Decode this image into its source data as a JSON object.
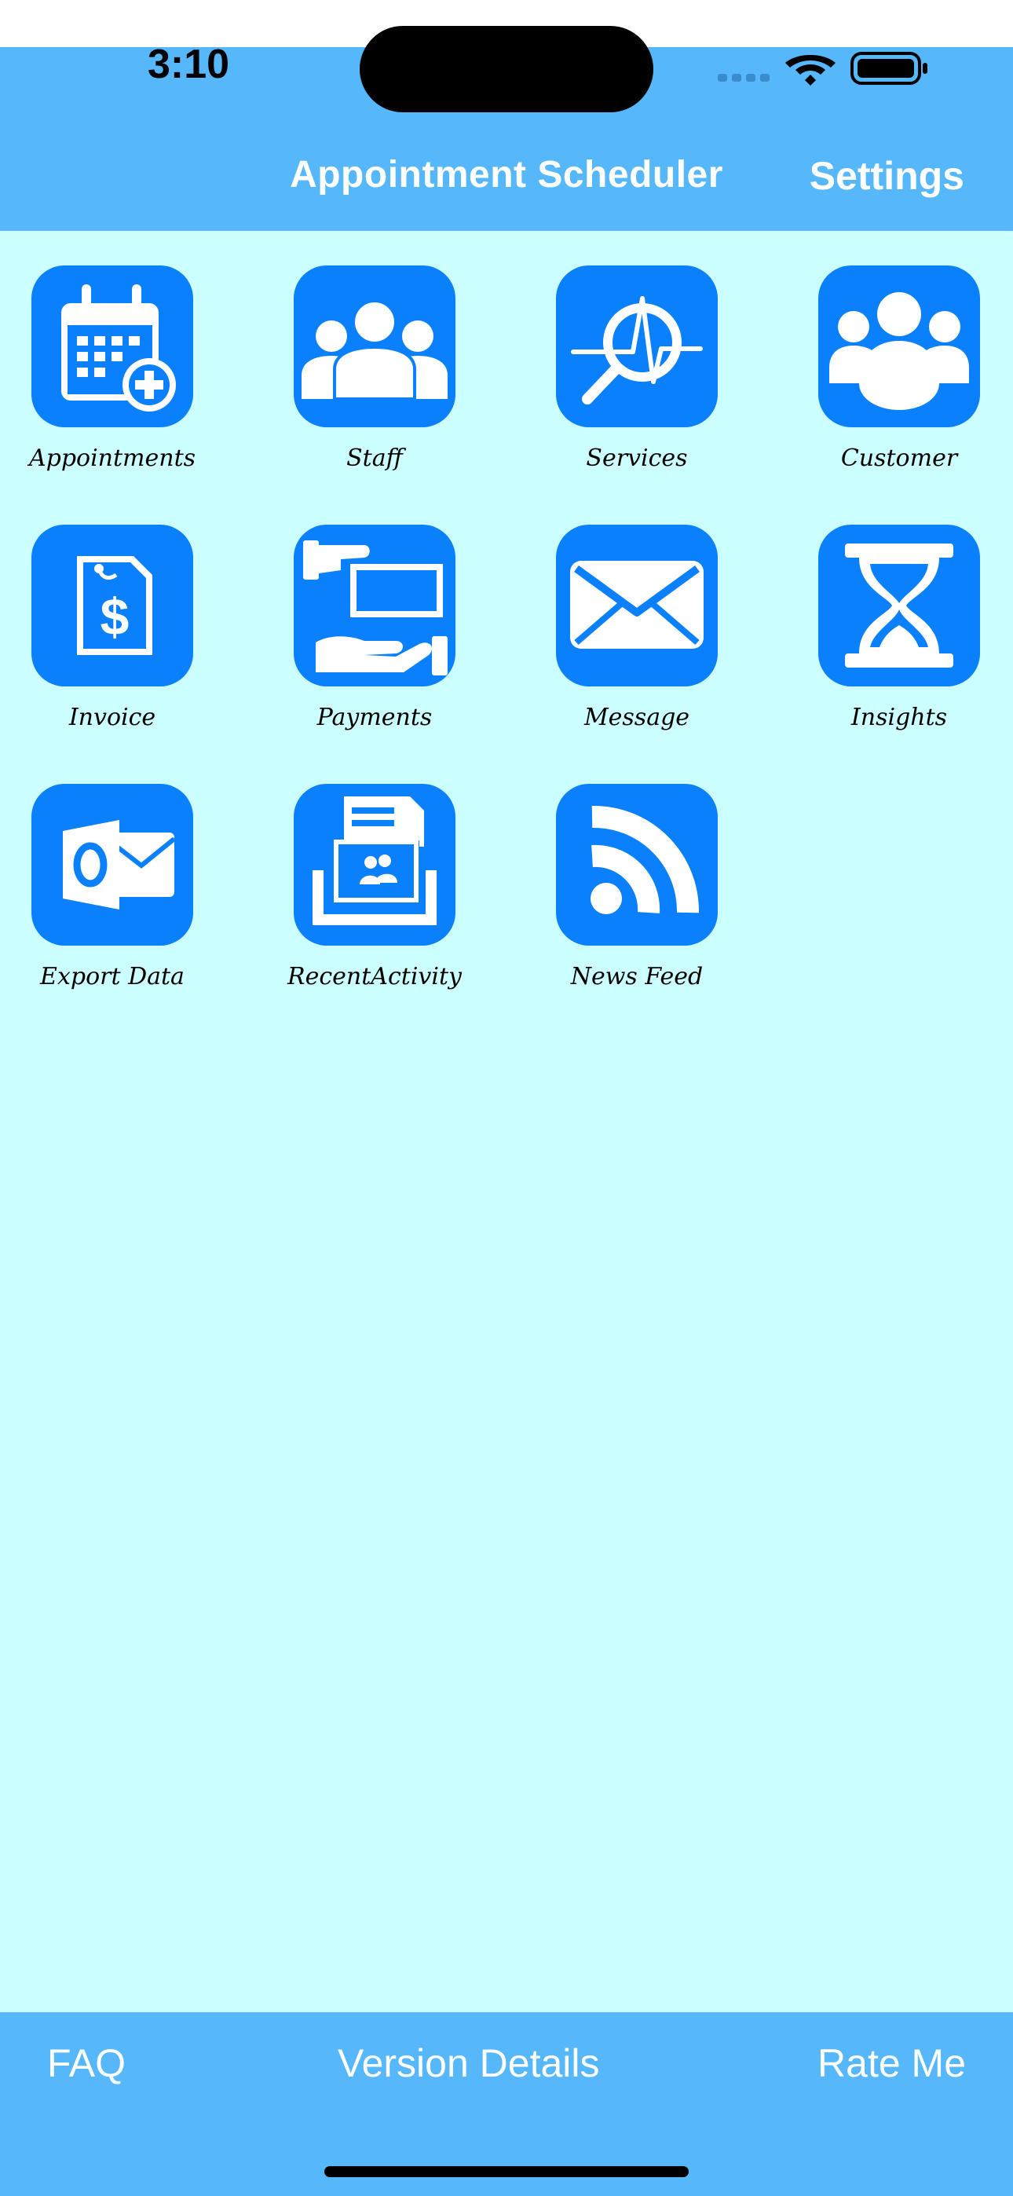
{
  "status_bar": {
    "time": "3:10"
  },
  "header": {
    "title": "Appointment Scheduler",
    "settings_label": "Settings"
  },
  "colors": {
    "header_bg": "#56b8fb",
    "page_bg": "#ccffff",
    "icon_bg": "#0a80fc",
    "icon_fg": "#ffffff"
  },
  "menu": [
    {
      "label": "Appointments",
      "icon": "calendar-add-icon"
    },
    {
      "label": "Staff",
      "icon": "staff-group-icon"
    },
    {
      "label": "Services",
      "icon": "services-magnifier-icon"
    },
    {
      "label": "Customer",
      "icon": "customer-group-icon"
    },
    {
      "label": "Invoice",
      "icon": "invoice-dollar-icon"
    },
    {
      "label": "Payments",
      "icon": "payment-hand-icon"
    },
    {
      "label": "Message",
      "icon": "envelope-icon"
    },
    {
      "label": "Insights",
      "icon": "hourglass-icon"
    },
    {
      "label": "Export Data",
      "icon": "outlook-export-icon"
    },
    {
      "label": "RecentActivity",
      "icon": "recent-activity-icon"
    },
    {
      "label": "News Feed",
      "icon": "rss-feed-icon"
    }
  ],
  "footer": {
    "faq": "FAQ",
    "version": "Version Details",
    "rate": "Rate Me"
  }
}
